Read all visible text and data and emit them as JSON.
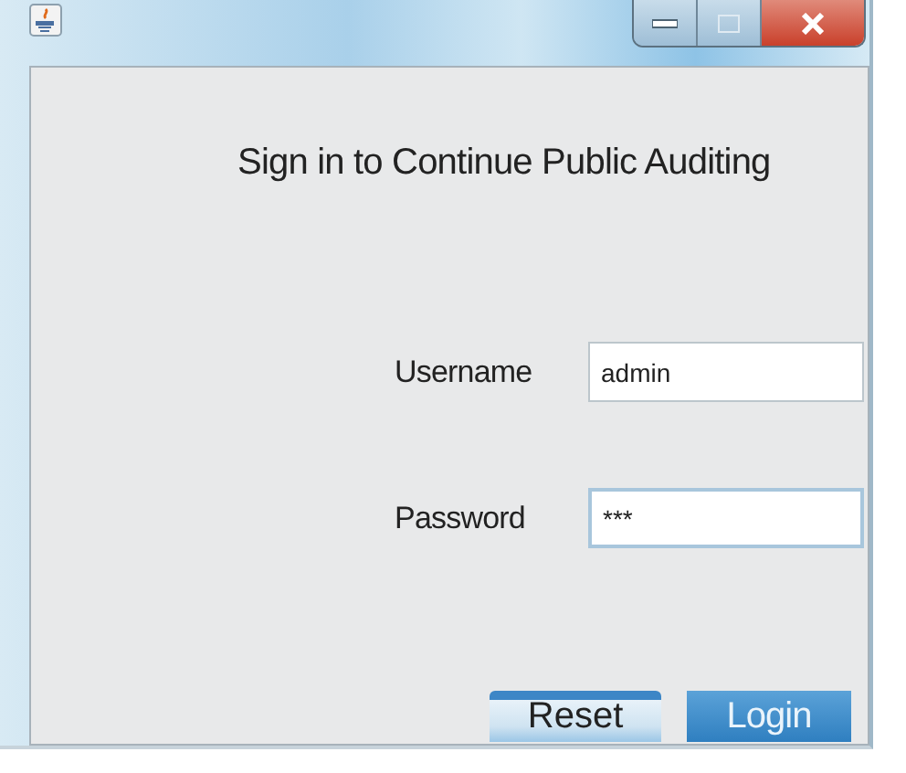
{
  "window": {
    "title": "Sign in to Continue Public Auditing"
  },
  "fields": [
    {
      "label": "Username",
      "value": "admin",
      "focused": false
    },
    {
      "label": "Password",
      "value": "***",
      "focused": true
    }
  ],
  "buttons": [
    {
      "label": "Reset",
      "kind": "secondary"
    },
    {
      "label": "Login",
      "kind": "primary"
    }
  ]
}
